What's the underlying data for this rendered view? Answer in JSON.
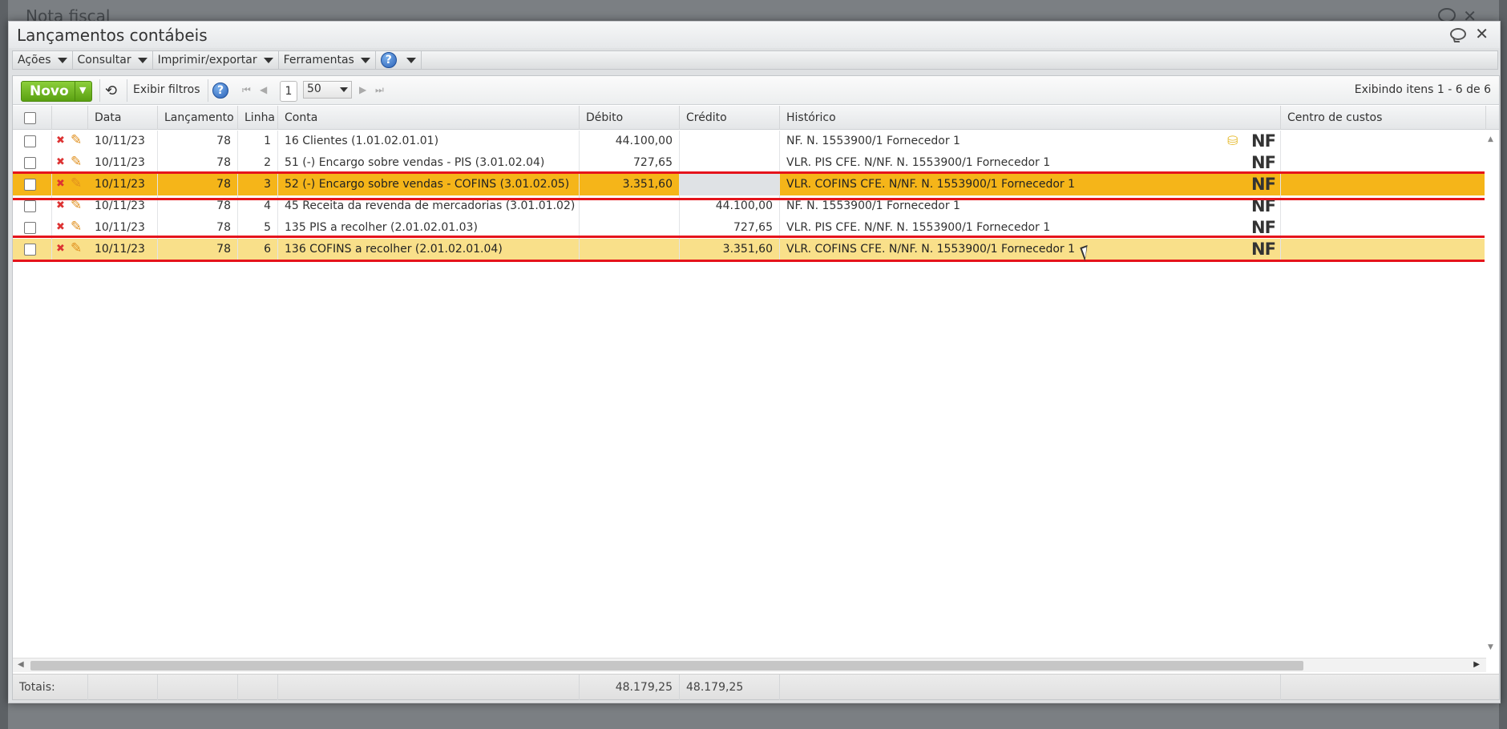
{
  "background": {
    "title": "Nota fiscal"
  },
  "dialog": {
    "title": "Lançamentos contábeis"
  },
  "menu": {
    "acoes": "Ações",
    "consultar": "Consultar",
    "imprimir": "Imprimir/exportar",
    "ferramentas": "Ferramentas",
    "help": "?"
  },
  "toolbar": {
    "novo": "Novo",
    "novo_arrow": "▼",
    "filters": "Exibir filtros",
    "help": "?",
    "page": "1",
    "page_size": "50",
    "items_info": "Exibindo itens 1 - 6 de 6"
  },
  "columns": {
    "data": "Data",
    "lancamento": "Lançamento",
    "linha": "Linha",
    "conta": "Conta",
    "debito": "Débito",
    "credito": "Crédito",
    "historico": "Histórico",
    "centro": "Centro de custos"
  },
  "rows": [
    {
      "data": "10/11/23",
      "lancamento": "78",
      "linha": "1",
      "conta": "16 Clientes (1.01.02.01.01)",
      "debito": "44.100,00",
      "credito": "",
      "historico": "NF. N. 1553900/1 Fornecedor 1",
      "nf": "NF",
      "centro": ""
    },
    {
      "data": "10/11/23",
      "lancamento": "78",
      "linha": "2",
      "conta": "51 (-) Encargo sobre vendas - PIS (3.01.02.04)",
      "debito": "727,65",
      "credito": "",
      "historico": "VLR. PIS CFE. N/NF. N. 1553900/1 Fornecedor 1",
      "nf": "NF",
      "centro": ""
    },
    {
      "data": "10/11/23",
      "lancamento": "78",
      "linha": "3",
      "conta": "52 (-) Encargo sobre vendas - COFINS (3.01.02.05)",
      "debito": "3.351,60",
      "credito": "",
      "historico": "VLR. COFINS CFE. N/NF. N. 1553900/1 Fornecedor 1",
      "nf": "NF",
      "centro": ""
    },
    {
      "data": "10/11/23",
      "lancamento": "78",
      "linha": "4",
      "conta": "45 Receita da revenda de mercadorias (3.01.01.02)",
      "debito": "",
      "credito": "44.100,00",
      "historico": "NF. N. 1553900/1 Fornecedor 1",
      "nf": "NF",
      "centro": ""
    },
    {
      "data": "10/11/23",
      "lancamento": "78",
      "linha": "5",
      "conta": "135 PIS a recolher (2.01.02.01.03)",
      "debito": "",
      "credito": "727,65",
      "historico": "VLR. PIS CFE. N/NF. N. 1553900/1 Fornecedor 1",
      "nf": "NF",
      "centro": ""
    },
    {
      "data": "10/11/23",
      "lancamento": "78",
      "linha": "6",
      "conta": "136 COFINS a recolher (2.01.02.01.04)",
      "debito": "",
      "credito": "3.351,60",
      "historico": "VLR. COFINS CFE. N/NF. N. 1553900/1 Fornecedor 1",
      "nf": "NF",
      "centro": ""
    }
  ],
  "totals": {
    "label": "Totais:",
    "debito": "48.179,25",
    "credito": "48.179,25"
  },
  "colors": {
    "selected": "#f5b519",
    "hover": "#f9e08a",
    "highlight": "#e5141b",
    "novo": "#6fb523"
  }
}
